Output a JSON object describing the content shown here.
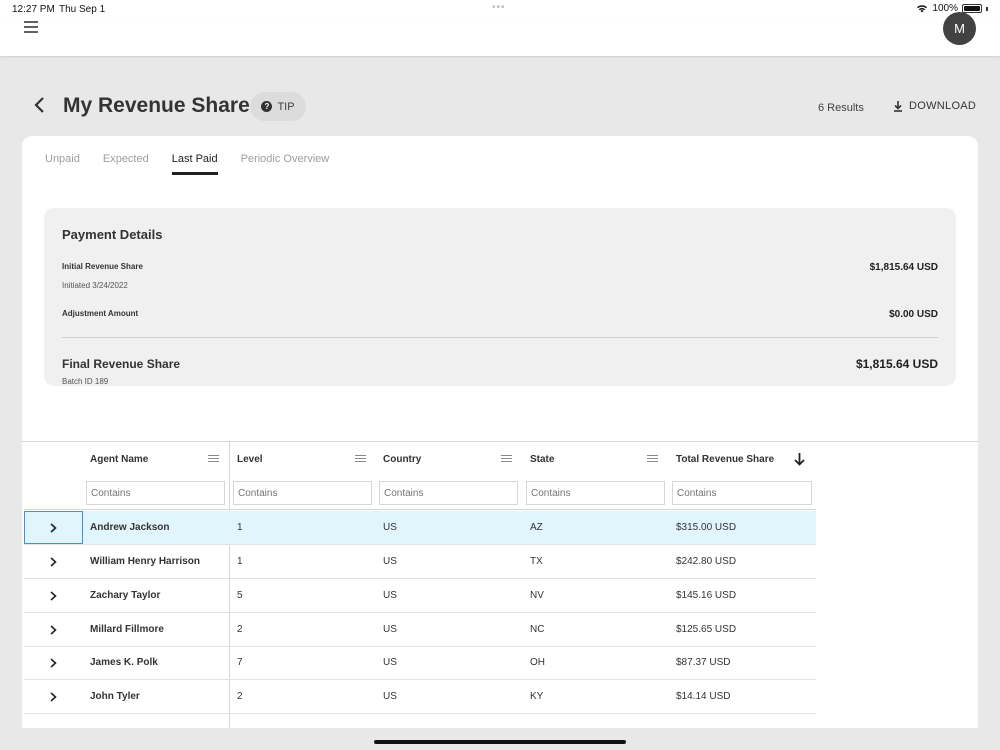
{
  "status_bar": {
    "time": "12:27 PM",
    "date": "Thu Sep 1",
    "battery": "100%"
  },
  "appbar": {
    "avatar_initial": "M"
  },
  "header": {
    "title": "My Revenue Share",
    "tip_label": "TIP",
    "results": "6 Results",
    "download_label": "DOWNLOAD"
  },
  "tabs": [
    {
      "label": "Unpaid"
    },
    {
      "label": "Expected"
    },
    {
      "label": "Last Paid",
      "active": true
    },
    {
      "label": "Periodic Overview"
    }
  ],
  "payment_details": {
    "title": "Payment Details",
    "initial_label": "Initial Revenue Share",
    "initial_sub": "Initiated 3/24/2022",
    "initial_amount": "$1,815.64 USD",
    "adjustment_label": "Adjustment Amount",
    "adjustment_amount": "$0.00 USD",
    "final_label": "Final Revenue Share",
    "final_amount": "$1,815.64 USD",
    "batch": "Batch ID 189"
  },
  "grid": {
    "columns": [
      {
        "label": "Agent Name",
        "filter_placeholder": "Contains"
      },
      {
        "label": "Level",
        "filter_placeholder": "Contains"
      },
      {
        "label": "Country",
        "filter_placeholder": "Contains"
      },
      {
        "label": "State",
        "filter_placeholder": "Contains"
      },
      {
        "label": "Total Revenue Share",
        "filter_placeholder": "Contains",
        "sort": "descending"
      }
    ],
    "rows": [
      {
        "name": "Andrew Jackson",
        "level": "1",
        "country": "US",
        "state": "AZ",
        "total": "$315.00 USD",
        "selected": true
      },
      {
        "name": "William Henry Harrison",
        "level": "1",
        "country": "US",
        "state": "TX",
        "total": "$242.80 USD"
      },
      {
        "name": "Zachary Taylor",
        "level": "5",
        "country": "US",
        "state": "NV",
        "total": "$145.16 USD"
      },
      {
        "name": "Millard Fillmore",
        "level": "2",
        "country": "US",
        "state": "NC",
        "total": "$125.65 USD"
      },
      {
        "name": "James K. Polk",
        "level": "7",
        "country": "US",
        "state": "OH",
        "total": "$87.37 USD"
      },
      {
        "name": "John Tyler",
        "level": "2",
        "country": "US",
        "state": "KY",
        "total": "$14.14 USD"
      }
    ]
  },
  "colors": {
    "selected_row": "#e1f5fc",
    "selected_border": "#3f8fd9",
    "background": "#e8e8e8"
  }
}
